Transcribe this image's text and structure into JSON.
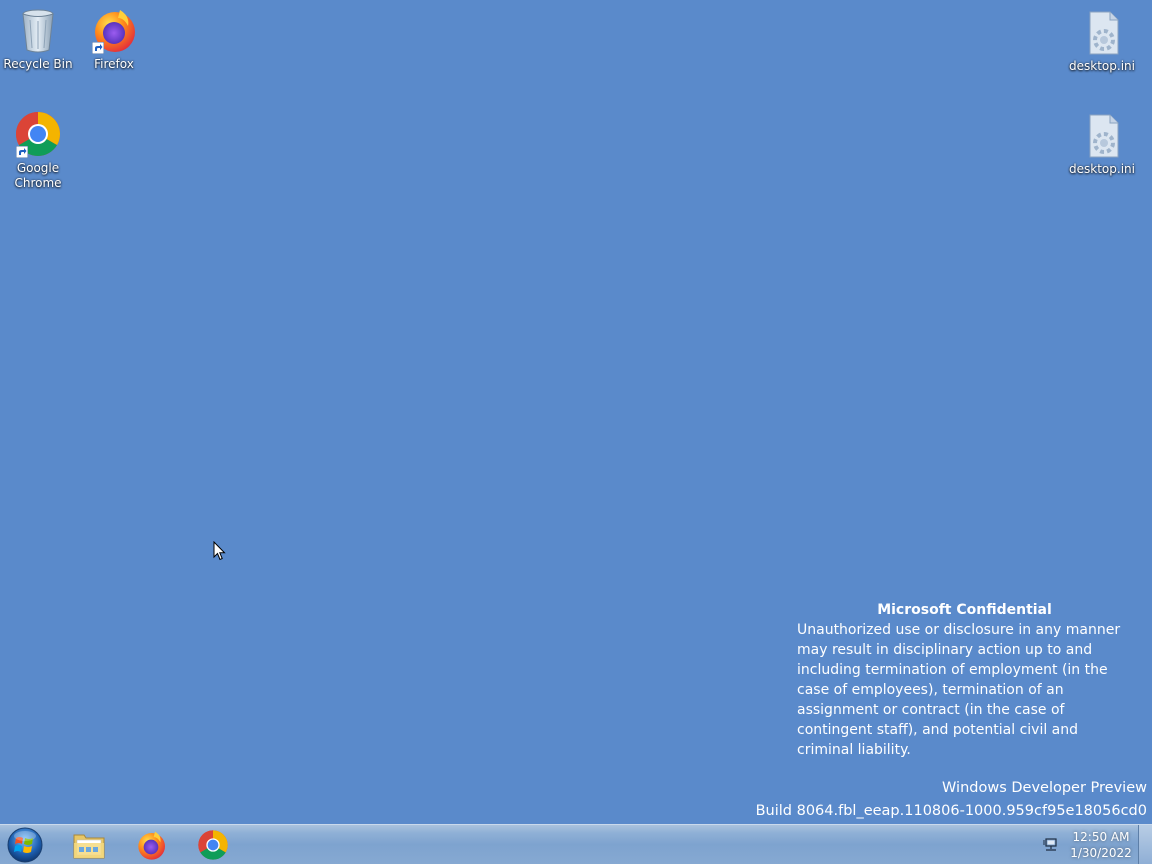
{
  "desktop": {
    "background_color": "#5a8acb",
    "icons": [
      {
        "label": "Recycle Bin",
        "icon": "recycle-bin-icon"
      },
      {
        "label": "Firefox",
        "icon": "firefox-icon"
      },
      {
        "label": "Google Chrome",
        "icon": "chrome-icon"
      },
      {
        "label": "desktop.ini",
        "icon": "settings-file-icon"
      },
      {
        "label": "desktop.ini",
        "icon": "settings-file-icon"
      }
    ]
  },
  "watermark": {
    "confidential_title": "Microsoft Confidential",
    "confidential_body": "Unauthorized use or disclosure in any manner may result in disciplinary action up to and including termination of employment (in the case of employees), termination of an assignment or contract (in the case of contingent staff), and potential civil and criminal liability.",
    "product": "Windows Developer Preview",
    "build": "Build 8064.fbl_eeap.110806-1000.959cf95e18056cd0"
  },
  "taskbar": {
    "start": {
      "icon": "windows-start-orb-icon"
    },
    "pinned": [
      {
        "name": "Windows Explorer",
        "icon": "folder-icon"
      },
      {
        "name": "Firefox",
        "icon": "firefox-icon"
      },
      {
        "name": "Google Chrome",
        "icon": "chrome-icon"
      }
    ],
    "tray": {
      "network_icon": "network-icon",
      "time": "12:50 AM",
      "date": "1/30/2022"
    }
  }
}
